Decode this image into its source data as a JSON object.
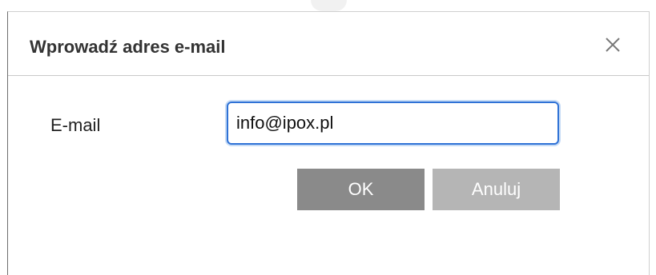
{
  "dialog": {
    "title": "Wprowadź adres e-mail",
    "close_icon": "close-icon"
  },
  "form": {
    "email_label": "E-mail",
    "email_value": "info@ipox.pl"
  },
  "buttons": {
    "ok_label": "OK",
    "cancel_label": "Anuluj"
  },
  "colors": {
    "ok_button": "#8a8a8a",
    "cancel_button": "#b5b5b5",
    "input_focus_border": "#2f72d6"
  }
}
